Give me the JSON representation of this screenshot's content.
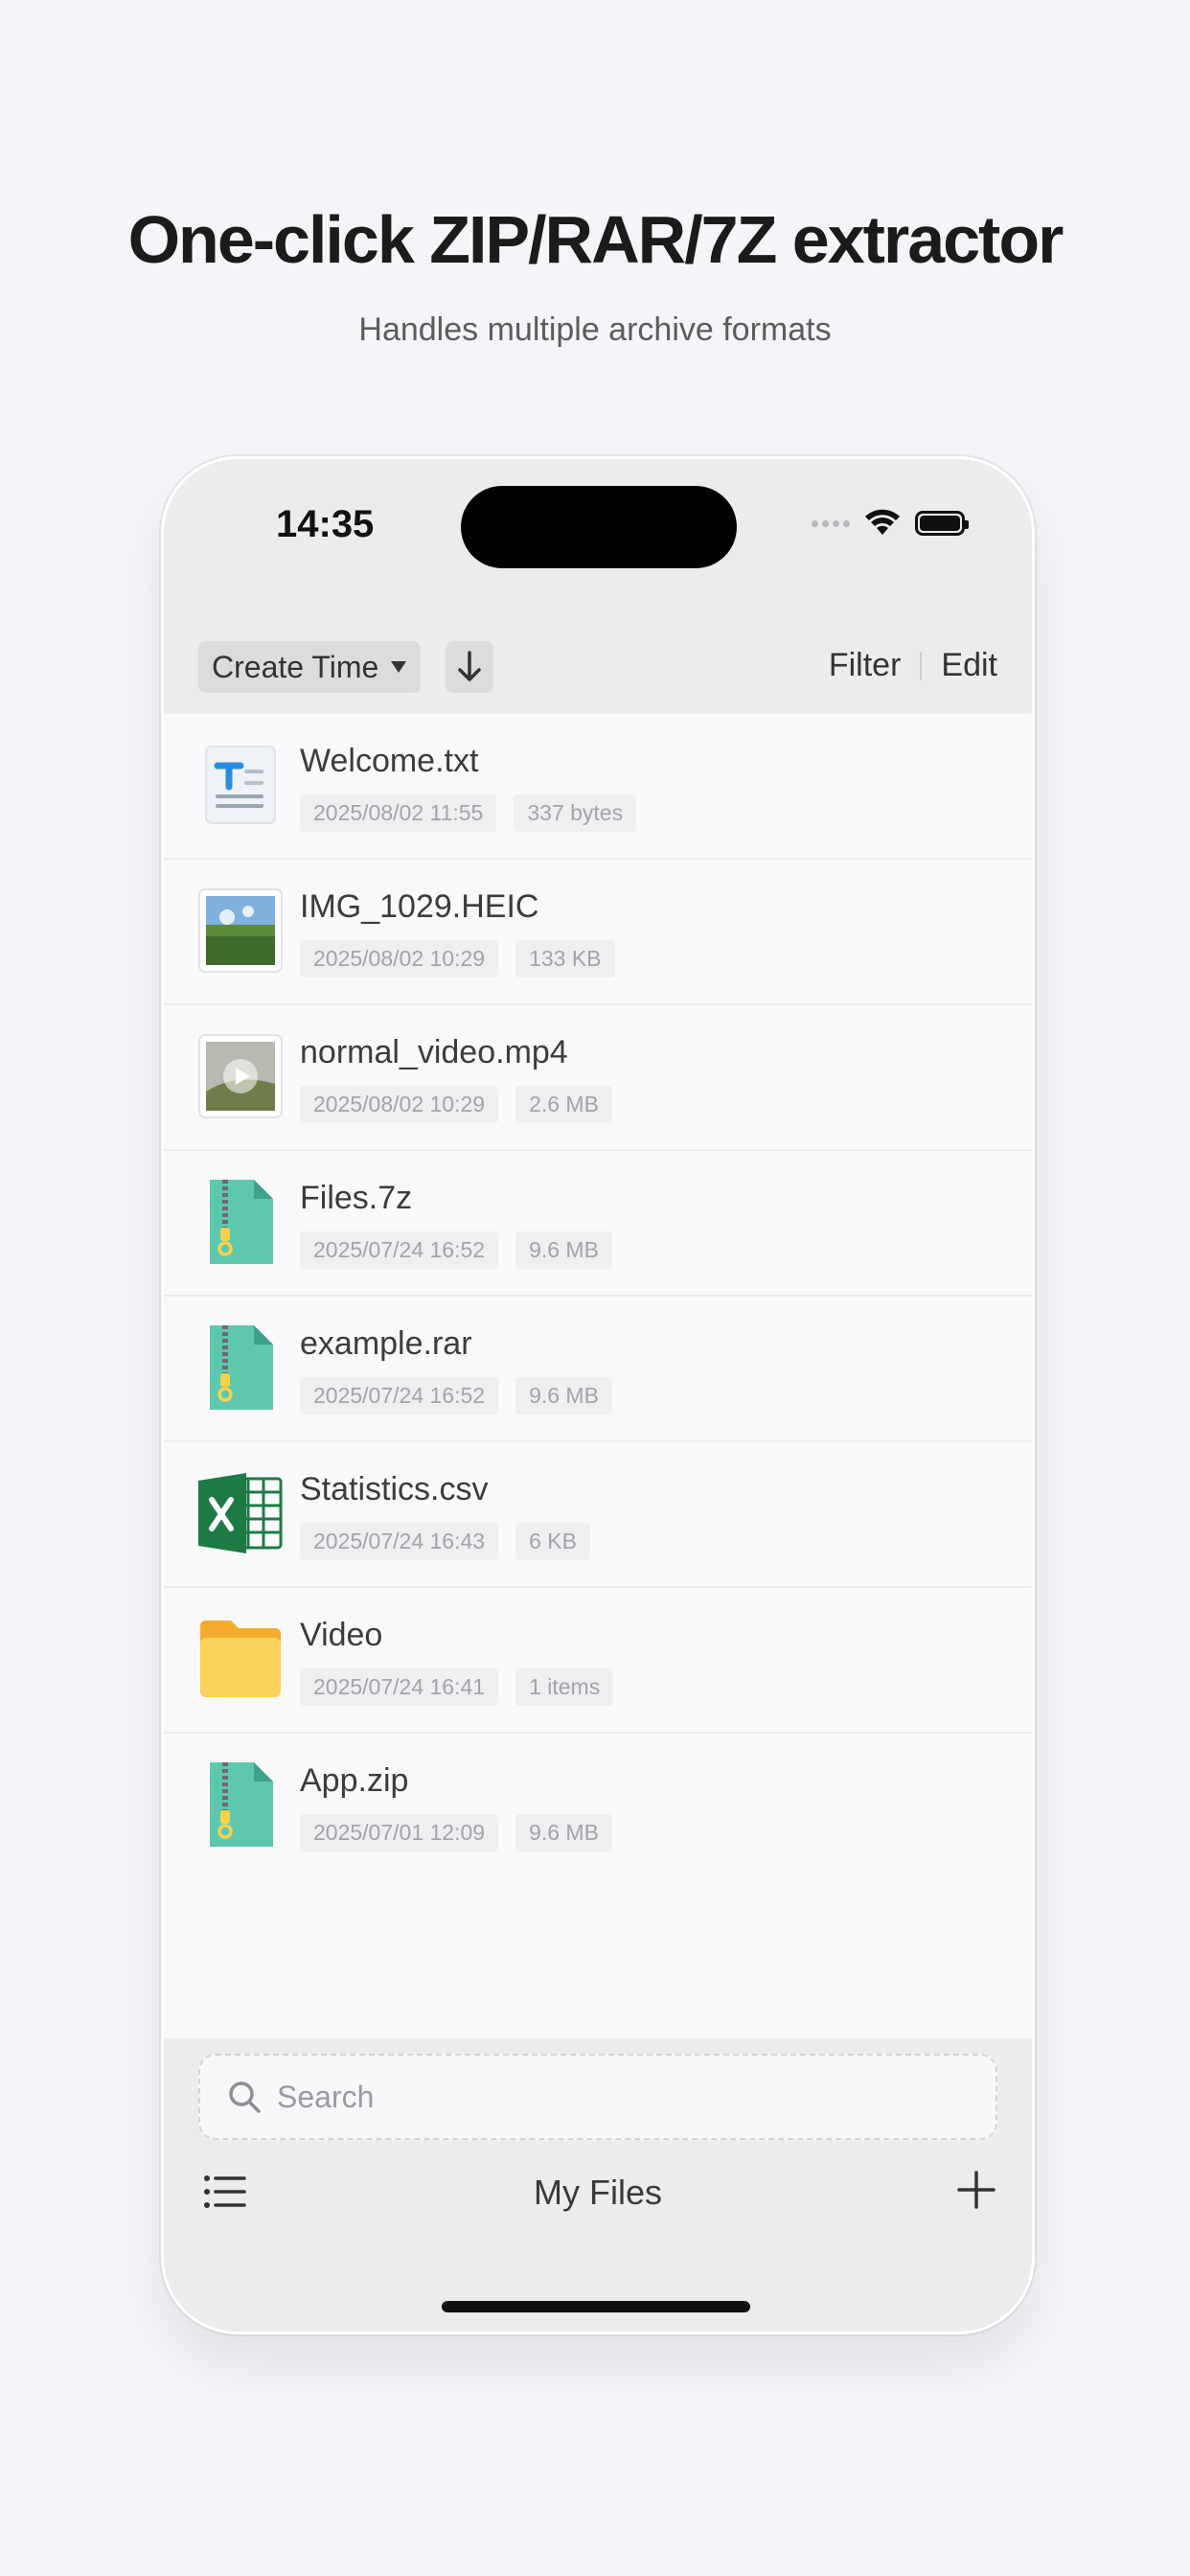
{
  "headline": "One-click ZIP/RAR/7Z extractor",
  "subline": "Handles multiple archive formats",
  "status_bar": {
    "time": "14:35"
  },
  "toolbar": {
    "sort_label": "Create Time",
    "filter_label": "Filter",
    "edit_label": "Edit"
  },
  "files": [
    {
      "name": "Welcome.txt",
      "date": "2025/08/02 11:55",
      "size": "337 bytes",
      "icon": "text-file-icon"
    },
    {
      "name": "IMG_1029.HEIC",
      "date": "2025/08/02 10:29",
      "size": "133 KB",
      "icon": "image-thumbnail-icon"
    },
    {
      "name": "normal_video.mp4",
      "date": "2025/08/02 10:29",
      "size": "2.6 MB",
      "icon": "video-thumbnail-icon"
    },
    {
      "name": "Files.7z",
      "date": "2025/07/24 16:52",
      "size": "9.6 MB",
      "icon": "archive-icon"
    },
    {
      "name": "example.rar",
      "date": "2025/07/24 16:52",
      "size": "9.6 MB",
      "icon": "archive-icon"
    },
    {
      "name": "Statistics.csv",
      "date": "2025/07/24 16:43",
      "size": "6 KB",
      "icon": "excel-icon"
    },
    {
      "name": "Video",
      "date": "2025/07/24 16:41",
      "size": "1 items",
      "icon": "folder-icon"
    },
    {
      "name": "App.zip",
      "date": "2025/07/01 12:09",
      "size": "9.6 MB",
      "icon": "archive-icon"
    }
  ],
  "search": {
    "placeholder": "Search"
  },
  "bottom_bar": {
    "title": "My Files"
  },
  "colors": {
    "archive": "#5ec8ae",
    "excel": "#1d7a45",
    "folder": "#fcc94a",
    "text_icon_blue": "#2a8ee0"
  }
}
